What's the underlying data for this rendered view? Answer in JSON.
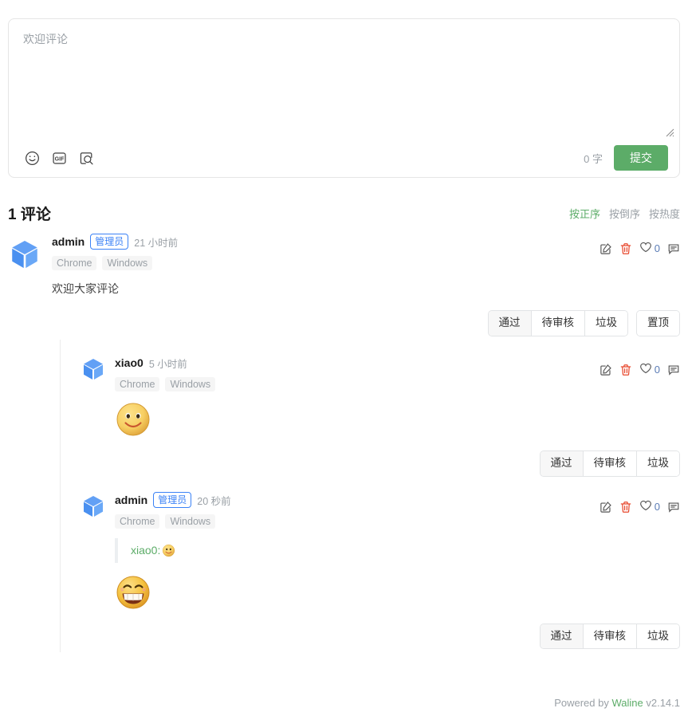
{
  "editor": {
    "placeholder": "欢迎评论",
    "value": "",
    "word_count": "0 字",
    "submit_label": "提交",
    "tools": [
      {
        "name": "emoji-icon",
        "title": "表情"
      },
      {
        "name": "gif-icon",
        "title": "GIF"
      },
      {
        "name": "image-search-icon",
        "title": "图片搜索"
      }
    ]
  },
  "header": {
    "count_title": "1 评论",
    "sort": [
      {
        "label": "按正序",
        "active": true
      },
      {
        "label": "按倒序",
        "active": false
      },
      {
        "label": "按热度",
        "active": false
      }
    ]
  },
  "status_buttons": {
    "approved": "通过",
    "waiting": "待审核",
    "spam": "垃圾",
    "sticky": "置顶"
  },
  "actions": {
    "edit": "edit-icon",
    "delete": "delete-icon",
    "like": "heart-icon",
    "reply": "reply-icon"
  },
  "comments": [
    {
      "nick": "admin",
      "badge": "管理员",
      "time": "21 小时前",
      "browser": "Chrome",
      "os": "Windows",
      "like_count": "0",
      "content": "欢迎大家评论",
      "quote": null,
      "emoji": null,
      "has_sticky": true
    },
    {
      "nick": "xiao0",
      "badge": null,
      "time": "5 小时前",
      "browser": "Chrome",
      "os": "Windows",
      "like_count": "0",
      "content": "",
      "quote": null,
      "emoji": "smiley-emoji",
      "has_sticky": false
    },
    {
      "nick": "admin",
      "badge": "管理员",
      "time": "20 秒前",
      "browser": "Chrome",
      "os": "Windows",
      "like_count": "0",
      "content": "",
      "quote": "xiao0:",
      "quote_emoji": "smiley-emoji",
      "emoji": "grin-emoji",
      "has_sticky": false
    }
  ],
  "footer": {
    "powered_prefix": "Powered by ",
    "brand": "Waline",
    "version": " v2.14.1"
  },
  "colors": {
    "accent_green": "#5cac68",
    "badge_blue": "#3b82f6",
    "delete_red": "#e8472c",
    "muted": "#9aa0a6"
  }
}
